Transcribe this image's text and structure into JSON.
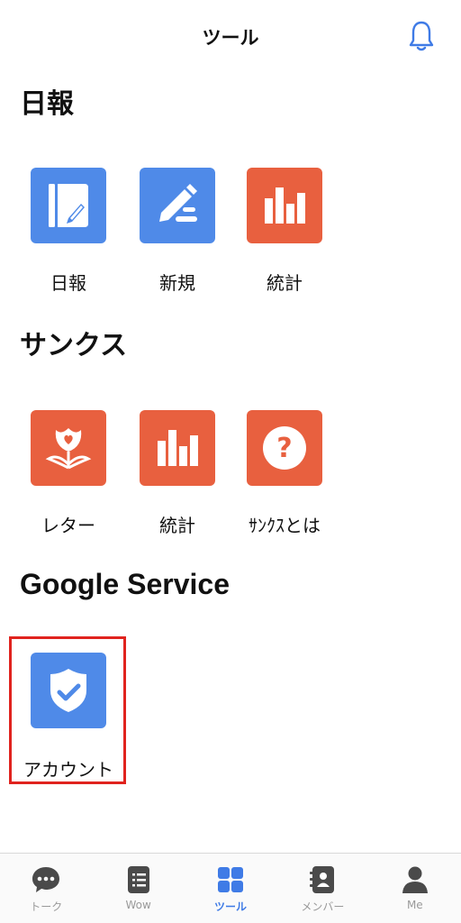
{
  "header": {
    "title": "ツール",
    "bell_icon": "bell-icon"
  },
  "sections": [
    {
      "title": "日報",
      "tiles": [
        {
          "label": "日報",
          "icon": "notebook-edit-icon",
          "color": "#4f8ae8"
        },
        {
          "label": "新規",
          "icon": "pencil-icon",
          "color": "#4f8ae8"
        },
        {
          "label": "統計",
          "icon": "bar-chart-icon",
          "color": "#e8603f"
        }
      ]
    },
    {
      "title": "サンクス",
      "tiles": [
        {
          "label": "レター",
          "icon": "heart-flower-icon",
          "color": "#e8603f"
        },
        {
          "label": "統計",
          "icon": "bar-chart-icon",
          "color": "#e8603f"
        },
        {
          "label": "ｻﾝｸｽとは",
          "icon": "question-icon",
          "color": "#e8603f"
        }
      ]
    },
    {
      "title": "Google Service",
      "tiles": [
        {
          "label": "アカウント",
          "icon": "shield-check-icon",
          "color": "#4f8ae8",
          "highlighted": true
        }
      ]
    }
  ],
  "tabbar": {
    "active": "ツール",
    "items": [
      {
        "label": "トーク",
        "icon": "chat-icon"
      },
      {
        "label": "Wow",
        "icon": "list-icon"
      },
      {
        "label": "ツール",
        "icon": "grid-icon"
      },
      {
        "label": "メンバー",
        "icon": "contacts-icon"
      },
      {
        "label": "Me",
        "icon": "person-icon"
      }
    ]
  },
  "colors": {
    "accent": "#3f7be6",
    "blue_tile": "#4f8ae8",
    "red_tile": "#e8603f",
    "highlight": "#e0231e"
  }
}
